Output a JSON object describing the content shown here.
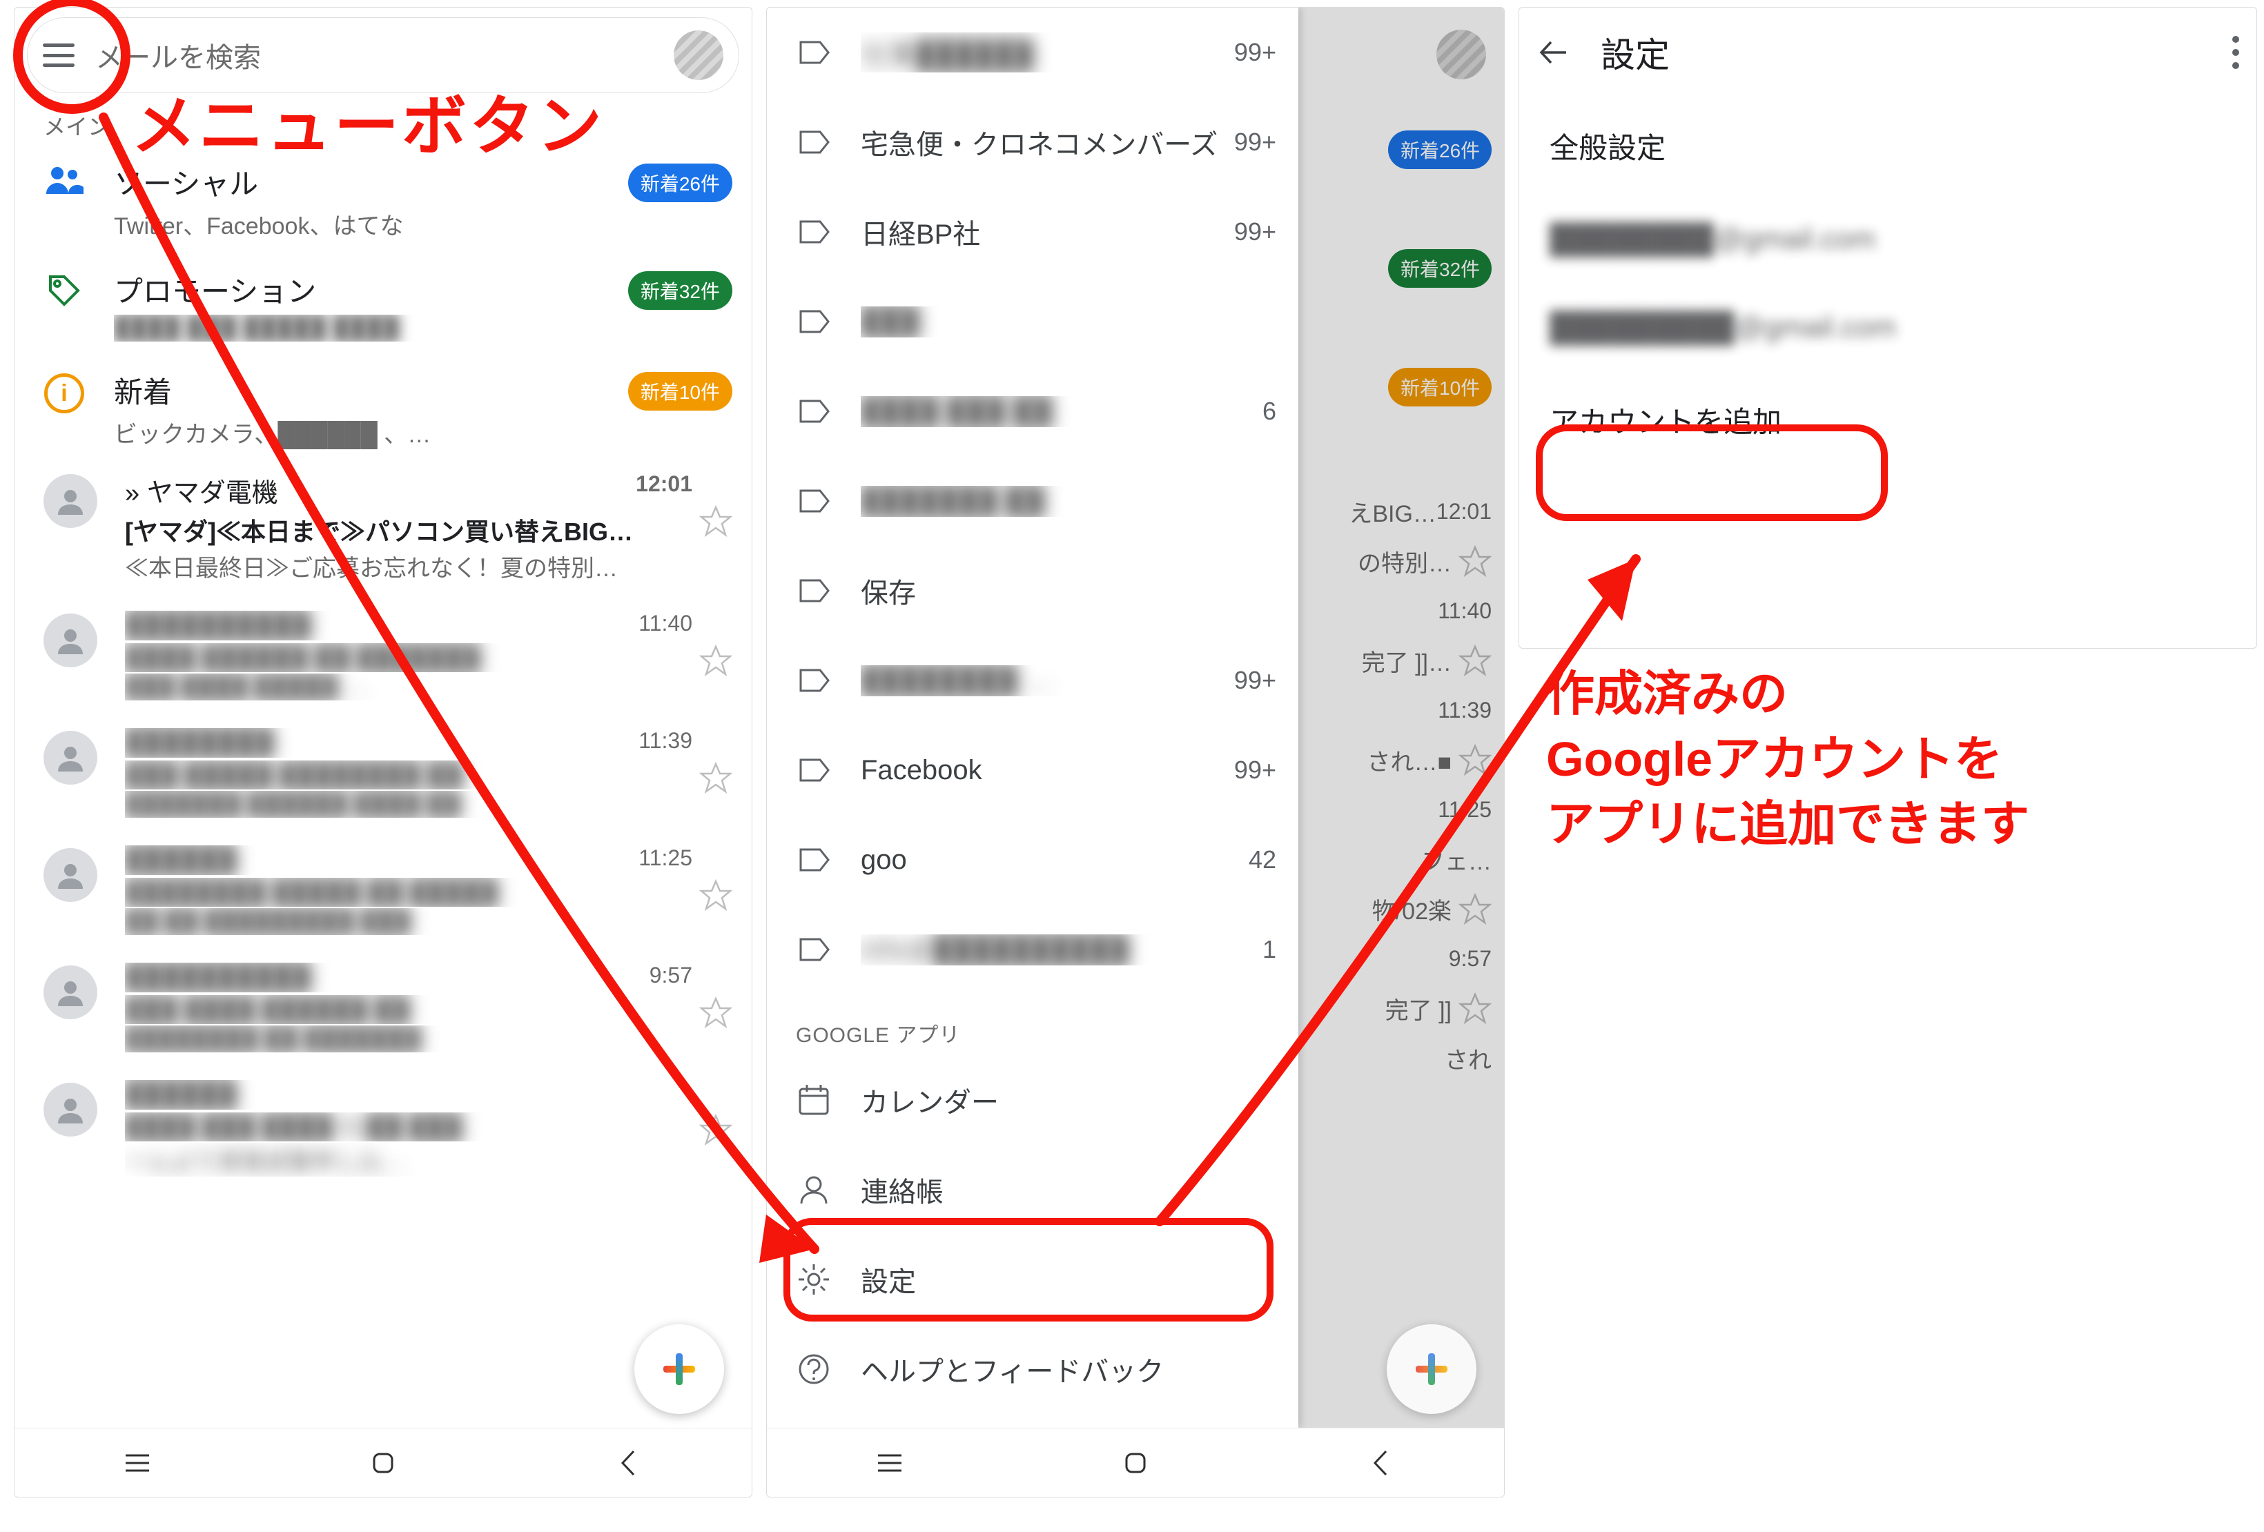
{
  "annotations": {
    "menu_button": "メニューボタン",
    "add_account_note_l1": "作成済みの",
    "add_account_note_l2": "Googleアカウントを",
    "add_account_note_l3": "アプリに追加できます"
  },
  "phone1": {
    "search_placeholder": "メールを検索",
    "main_label": "メイン",
    "categories": [
      {
        "title": "ソーシャル",
        "sub": "Twitter、Facebook、はてな",
        "badge": "新着26件",
        "badge_class": "b-blue"
      },
      {
        "title": "プロモーション",
        "sub": "████ ███ █████ ████",
        "badge": "新着32件",
        "badge_class": "b-green"
      },
      {
        "title": "新着",
        "sub": "ビックカメラ、██████ 、…",
        "badge": "新着10件",
        "badge_class": "b-orange"
      }
    ],
    "messages": [
      {
        "marker": "»",
        "from": "ヤマダ電機",
        "time": "12:01",
        "subject": "[ヤマダ]≪本日まで≫パソコン買い替えBIG…",
        "snippet": "≪本日最終日≫ご応募お忘れなく！夏の特別…",
        "bold": true
      },
      {
        "from": "██████████",
        "time": "11:40",
        "subject": "████ ██████ ██ ███████",
        "snippet": "███ ████ █████ …",
        "blur": true
      },
      {
        "from": "████████",
        "time": "11:39",
        "subject": "███ █████ ████████ ██",
        "snippet": "███████ ██████ ████ ██",
        "blur": true
      },
      {
        "from": "██████",
        "time": "11:25",
        "subject": "████████ █████ ██ █████",
        "snippet": "██ ██ █████████ ███",
        "blur": true
      },
      {
        "from": "██████████",
        "time": "9:57",
        "subject": "███ ████ ██████ ██",
        "snippet": "████████ ██ ███████",
        "blur": true
      },
      {
        "from": "██████",
        "time": "",
        "subject": "████ ███ ████ 01██ ███",
        "snippet": "ームより資格試験申し込…",
        "blur": true
      }
    ]
  },
  "phone2": {
    "labels": [
      {
        "label": "仕事██████",
        "count": "99+"
      },
      {
        "label": "宅急便・クロネコメンバーズ",
        "count": "99+"
      },
      {
        "label": "日経BP社",
        "count": "99+"
      },
      {
        "label": "███",
        "count": ""
      },
      {
        "label": "████ ███ ██",
        "count": "6"
      },
      {
        "label": "███████ ██",
        "count": ""
      },
      {
        "label": "保存",
        "count": ""
      },
      {
        "label": "████████ …",
        "count": "99+"
      },
      {
        "label": "Facebook",
        "count": "99+"
      },
      {
        "label": "goo",
        "count": "42"
      },
      {
        "label": "info@██████████",
        "count": "1"
      }
    ],
    "section_apps": "GOOGLE アプリ",
    "app_calendar": "カレンダー",
    "app_contacts": "連絡帳",
    "app_settings": "設定",
    "app_help": "ヘルプとフィードバック",
    "peek": {
      "badges": [
        "新着26件",
        "新着32件",
        "新着10件"
      ],
      "rows": [
        {
          "time": "12:01",
          "text": "えBIG…"
        },
        {
          "time": "",
          "text": "の特別…",
          "star": true
        },
        {
          "time": "11:40",
          "text": ""
        },
        {
          "time": "",
          "text": "完了 ]]…",
          "star": true
        },
        {
          "time": "11:39",
          "text": ""
        },
        {
          "time": "",
          "text": "され…■",
          "star": true
        },
        {
          "time": "11:25",
          "text": ""
        },
        {
          "time": "",
          "text": "フェ…"
        },
        {
          "time": "",
          "text": "物/02楽",
          "star": true
        },
        {
          "time": "9:57",
          "text": ""
        },
        {
          "time": "",
          "text": "完了 ]]",
          "star": true
        },
        {
          "time": "",
          "text": "され"
        }
      ]
    }
  },
  "phone3": {
    "title": "設定",
    "general": "全般設定",
    "account1_suffix": "@gmail.com",
    "account2_suffix": "@gmail.com",
    "add_account": "アカウントを追加"
  }
}
